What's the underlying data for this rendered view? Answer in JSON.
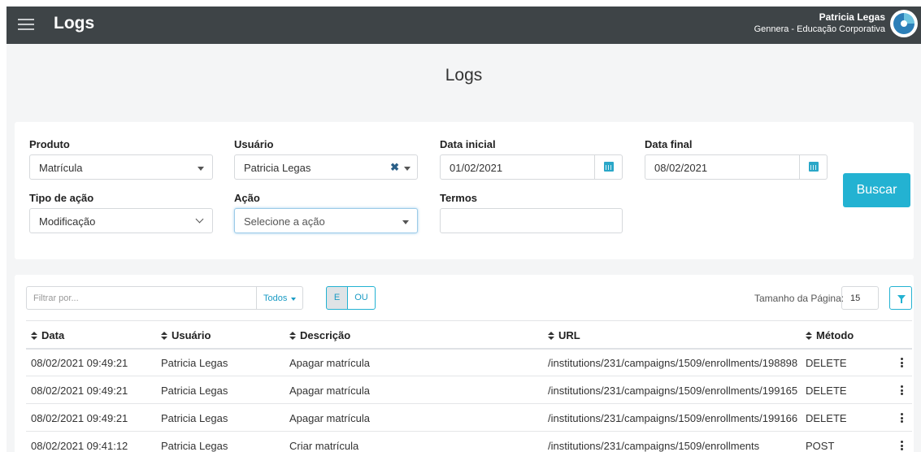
{
  "header": {
    "app_title": "Logs",
    "user_name": "Patricia Legas",
    "user_org": "Gennera - Educação Corporativa"
  },
  "page_title": "Logs",
  "filters": {
    "produto": {
      "label": "Produto",
      "value": "Matrícula"
    },
    "usuario": {
      "label": "Usuário",
      "value": "Patricia Legas"
    },
    "data_inicial": {
      "label": "Data inicial",
      "value": "01/02/2021"
    },
    "data_final": {
      "label": "Data final",
      "value": "08/02/2021"
    },
    "tipo_acao": {
      "label": "Tipo de ação",
      "value": "Modificação"
    },
    "acao": {
      "label": "Ação",
      "placeholder": "Selecione a ação"
    },
    "termos": {
      "label": "Termos",
      "value": ""
    },
    "buscar_label": "Buscar"
  },
  "table_toolbar": {
    "filter_placeholder": "Filtrar por...",
    "todos_label": "Todos",
    "e_label": "E",
    "ou_label": "OU",
    "page_size_label": "Tamanho da Página:",
    "page_size_value": "15"
  },
  "table": {
    "columns": [
      "Data",
      "Usuário",
      "Descrição",
      "URL",
      "Método"
    ],
    "rows": [
      [
        "08/02/2021 09:49:21",
        "Patricia Legas",
        "Apagar matrícula",
        "/institutions/231/campaigns/1509/enrollments/198898",
        "DELETE"
      ],
      [
        "08/02/2021 09:49:21",
        "Patricia Legas",
        "Apagar matrícula",
        "/institutions/231/campaigns/1509/enrollments/199165",
        "DELETE"
      ],
      [
        "08/02/2021 09:49:21",
        "Patricia Legas",
        "Apagar matrícula",
        "/institutions/231/campaigns/1509/enrollments/199166",
        "DELETE"
      ],
      [
        "08/02/2021 09:41:12",
        "Patricia Legas",
        "Criar matrícula",
        "/institutions/231/campaigns/1509/enrollments",
        "POST"
      ]
    ]
  },
  "colors": {
    "topbar": "#3e4447",
    "accent": "#23b2d2",
    "background": "#f4f5f6"
  }
}
